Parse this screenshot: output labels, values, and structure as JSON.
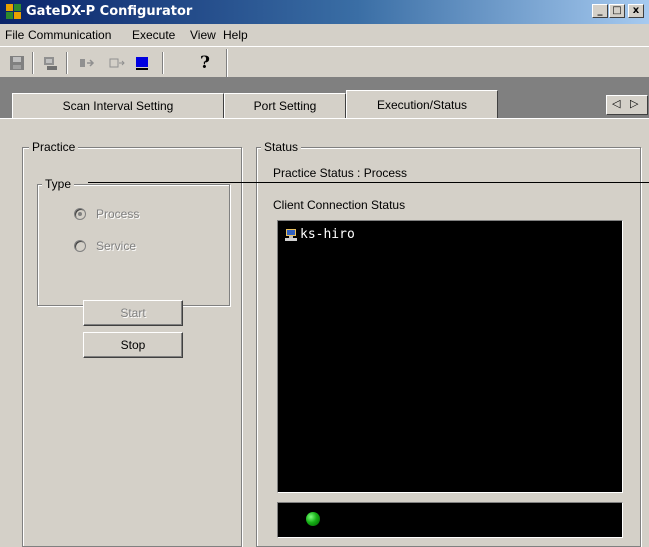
{
  "window": {
    "title": "GateDX-P Configurator"
  },
  "window_buttons": {
    "minimize": "_",
    "maximize": "□",
    "close": "x"
  },
  "menu": [
    "File",
    "Communication",
    "Execute",
    "View",
    "Help"
  ],
  "toolbar": {
    "icons": [
      "save-icon",
      "connect-icon",
      "transfer-icon",
      "monitor-icon",
      "blue-square-icon",
      "help-icon"
    ],
    "help_glyph": "?"
  },
  "tabs": [
    {
      "label": "Scan Interval Setting",
      "active": false
    },
    {
      "label": "Port Setting",
      "active": false
    },
    {
      "label": "Execution/Status",
      "active": true
    }
  ],
  "tab_scroll": {
    "left": "◁",
    "right": "▷"
  },
  "practice": {
    "title": "Practice",
    "type_title": "Type",
    "options": [
      {
        "label": "Process",
        "checked": true,
        "enabled": false
      },
      {
        "label": "Service",
        "checked": false,
        "enabled": false
      }
    ],
    "start_label": "Start",
    "start_enabled": false,
    "stop_label": "Stop",
    "stop_enabled": true
  },
  "status": {
    "title": "Status",
    "practice_status": "Practice Status : Process",
    "client_connection_label": "Client Connection Status",
    "clients": [
      "ks-hiro"
    ],
    "indicator_color": "#16b016"
  },
  "colors": {
    "titlebar_start": "#0a246a",
    "titlebar_end": "#a6caf0",
    "face": "#d4d0c8",
    "status_led": "#16b016"
  }
}
